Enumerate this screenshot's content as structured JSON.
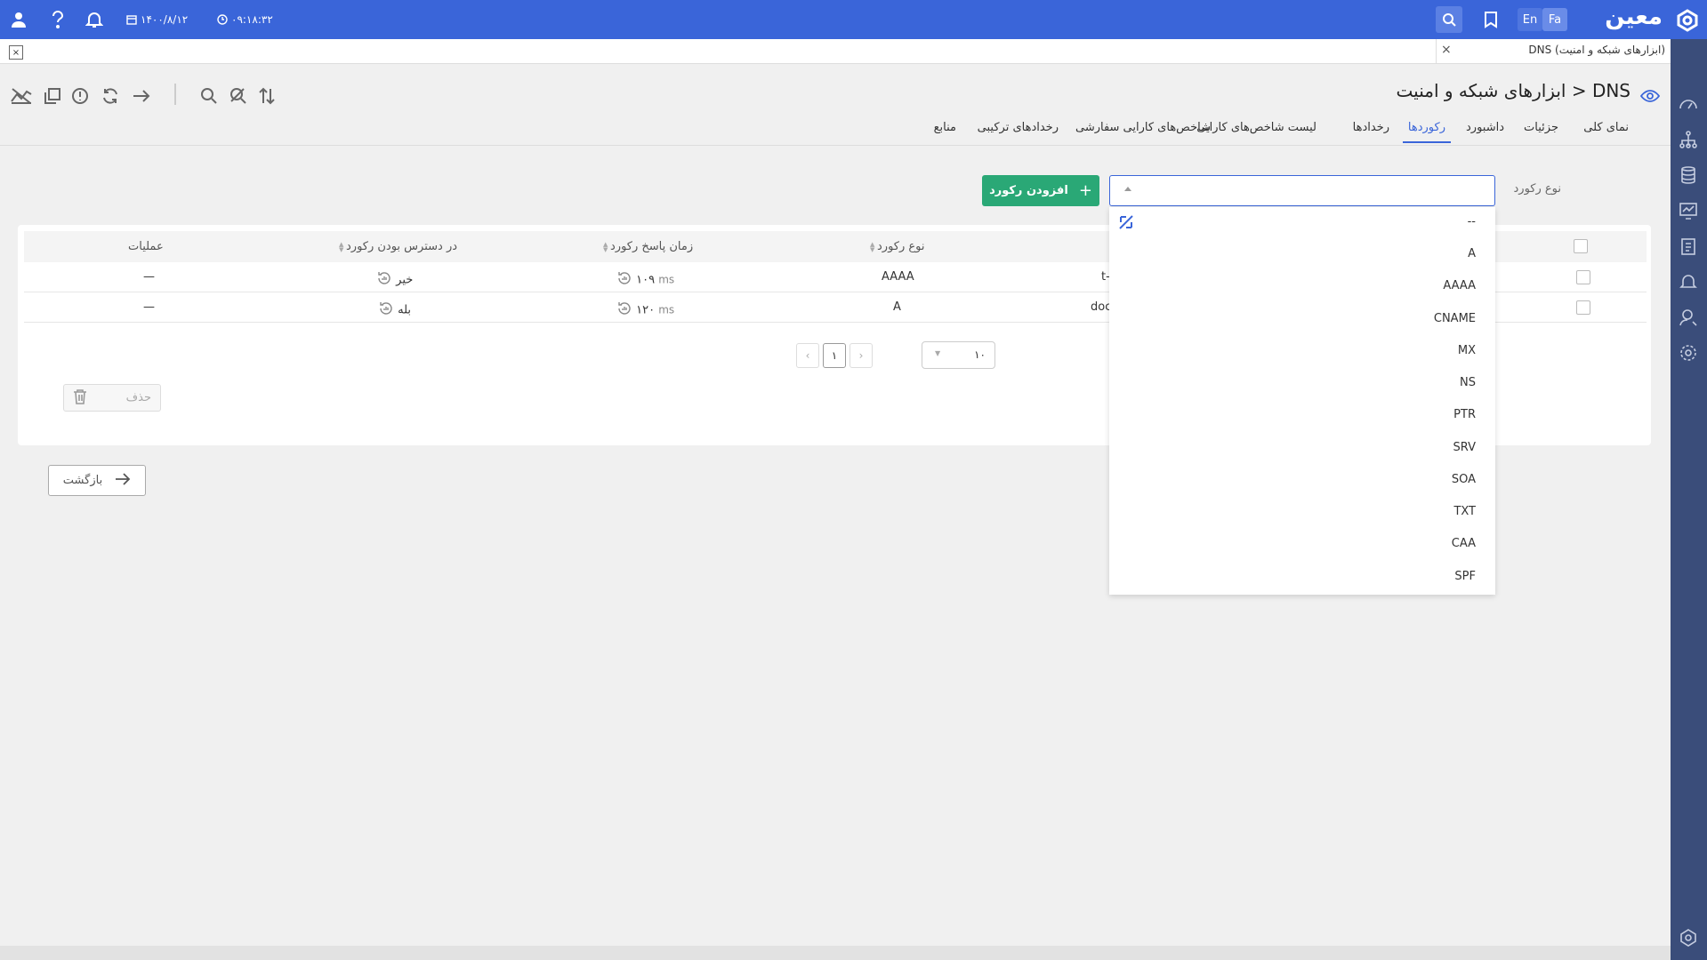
{
  "header": {
    "logo_text": "معین",
    "lang_fa": "Fa",
    "lang_en": "En",
    "date": "۱۴۰۰/۸/۱۲",
    "time": "۰۹:۱۸:۳۲"
  },
  "doc_tab": {
    "label": "DNS (ابزارهای شبکه و امنیت)",
    "close": "×"
  },
  "page": {
    "title": "ابزارهای شبکه و امنیت > DNS"
  },
  "tabs": [
    {
      "label": "نمای کلی"
    },
    {
      "label": "جزئیات"
    },
    {
      "label": "داشبورد"
    },
    {
      "label": "رکوردها"
    },
    {
      "label": "رخدادها"
    },
    {
      "label": "لیست شاخص‌های کارایی"
    },
    {
      "label": "شاخص‌های کارایی سفارشی"
    },
    {
      "label": "رخدادهای ترکیبی"
    },
    {
      "label": "منابع"
    }
  ],
  "filter": {
    "label": "نوع رکورد",
    "add_button": "افزودن رکورد",
    "options": [
      "--",
      "A",
      "AAAA",
      "CNAME",
      "MX",
      "NS",
      "PTR",
      "SRV",
      "SOA",
      "TXT",
      "CAA",
      "SPF"
    ]
  },
  "table": {
    "headers": {
      "type": "نوع رکورد",
      "response_time": "زمان پاسخ رکورد",
      "availability": "در دسترس بودن رکورد",
      "operations": "عملیات"
    },
    "rows": [
      {
        "name": "t-",
        "type": "AAAA",
        "response": "۱۰۹",
        "unit": "ms",
        "available": "خیر",
        "ops": "—"
      },
      {
        "name": "doc",
        "type": "A",
        "response": "۱۲۰",
        "unit": "ms",
        "available": "بله",
        "ops": "—"
      }
    ]
  },
  "pager": {
    "current": "۱",
    "page_size": "۱۰"
  },
  "actions": {
    "delete": "حذف",
    "back": "بازگشت"
  },
  "colors": {
    "primary": "#3a65d9",
    "success": "#2aa876",
    "sidebar": "#3a4d7a"
  }
}
